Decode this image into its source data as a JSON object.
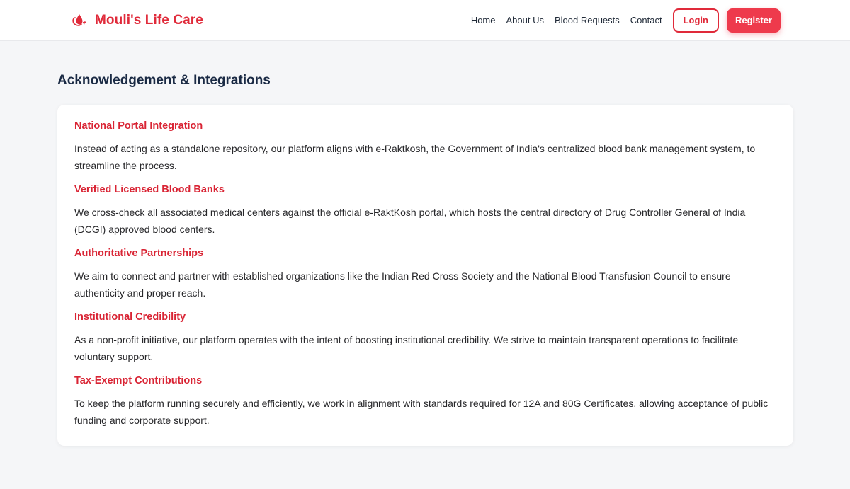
{
  "brand": {
    "name": "Mouli's Life Care",
    "logo_icon": "blood-drop-heart-icon",
    "color": "#e02a3a"
  },
  "nav": {
    "links": [
      {
        "label": "Home"
      },
      {
        "label": "About Us"
      },
      {
        "label": "Blood Requests"
      },
      {
        "label": "Contact"
      }
    ],
    "login_label": "Login",
    "register_label": "Register"
  },
  "page": {
    "title": "Acknowledgement & Integrations"
  },
  "sections": [
    {
      "title": "National Portal Integration",
      "text": "Instead of acting as a standalone repository, our platform aligns with e-Raktkosh, the Government of India's centralized blood bank management system, to streamline the process."
    },
    {
      "title": "Verified Licensed Blood Banks",
      "text": "We cross-check all associated medical centers against the official e-RaktKosh portal, which hosts the central directory of Drug Controller General of India (DCGI) approved blood centers."
    },
    {
      "title": "Authoritative Partnerships",
      "text": "We aim to connect and partner with established organizations like the Indian Red Cross Society and the National Blood Transfusion Council to ensure authenticity and proper reach."
    },
    {
      "title": "Institutional Credibility",
      "text": "As a non-profit initiative, our platform operates with the intent of boosting institutional credibility. We strive to maintain transparent operations to facilitate voluntary support."
    },
    {
      "title": "Tax-Exempt Contributions",
      "text": "To keep the platform running securely and efficiently, we work in alignment with standards required for 12A and 80G Certificates, allowing acceptance of public funding and corporate support."
    }
  ]
}
